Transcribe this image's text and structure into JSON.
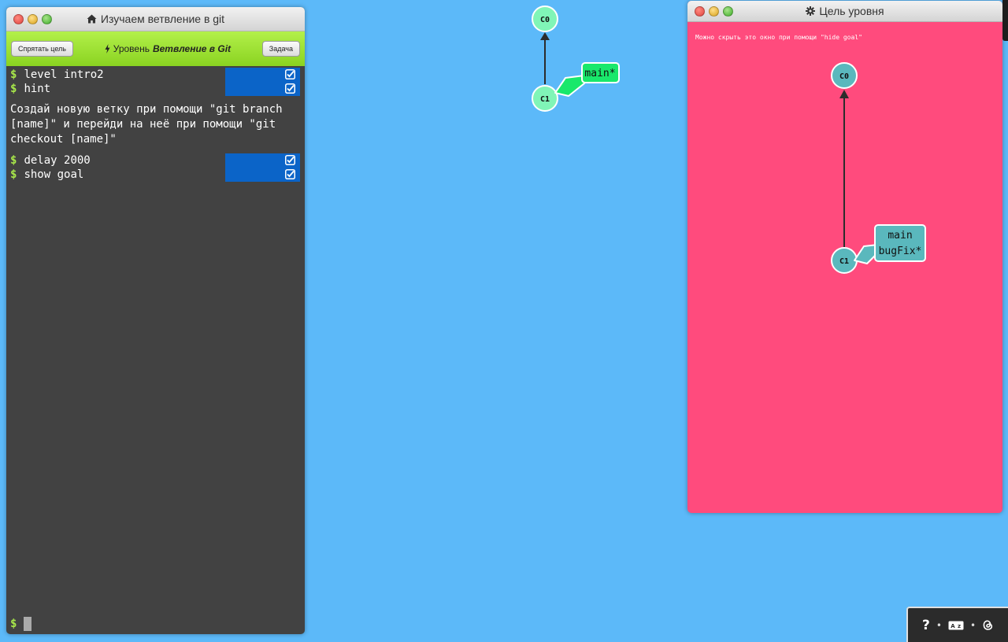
{
  "terminal": {
    "title": "Изучаем ветвление в git",
    "hide_goal_button": "Спрятать цель",
    "level_prefix": "Уровень",
    "level_name": "Ветвление в Git",
    "task_button": "Задача",
    "commands": [
      {
        "text": "level intro2"
      },
      {
        "text": "hint"
      }
    ],
    "hint": "Создай новую ветку при помощи \"git branch [name]\" и перейди на неё при помощи \"git checkout [name]\"",
    "commands2": [
      {
        "text": "delay 2000"
      },
      {
        "text": "show goal"
      }
    ],
    "prompt_symbol": "$",
    "accent_color": "#a8e84a",
    "done_color": "#0b64c8"
  },
  "main_graph": {
    "commits": [
      "C0",
      "C1"
    ],
    "branch_label": "main*",
    "branch_color": "#19e86b",
    "commit_color": "#80f5b7"
  },
  "goal": {
    "title": "Цель уровня",
    "note": "Можно скрыть это окно при помощи \"hide goal\"",
    "commits": [
      "C0",
      "C1"
    ],
    "branch_labels": [
      "main",
      "bugFix*"
    ],
    "background": "#ff4b7d",
    "commit_color": "#5ab8bd"
  },
  "controls": {
    "help": "?",
    "separator": "•",
    "keyboard_icon": "keyboard-icon",
    "theme_icon": "threads-icon"
  }
}
